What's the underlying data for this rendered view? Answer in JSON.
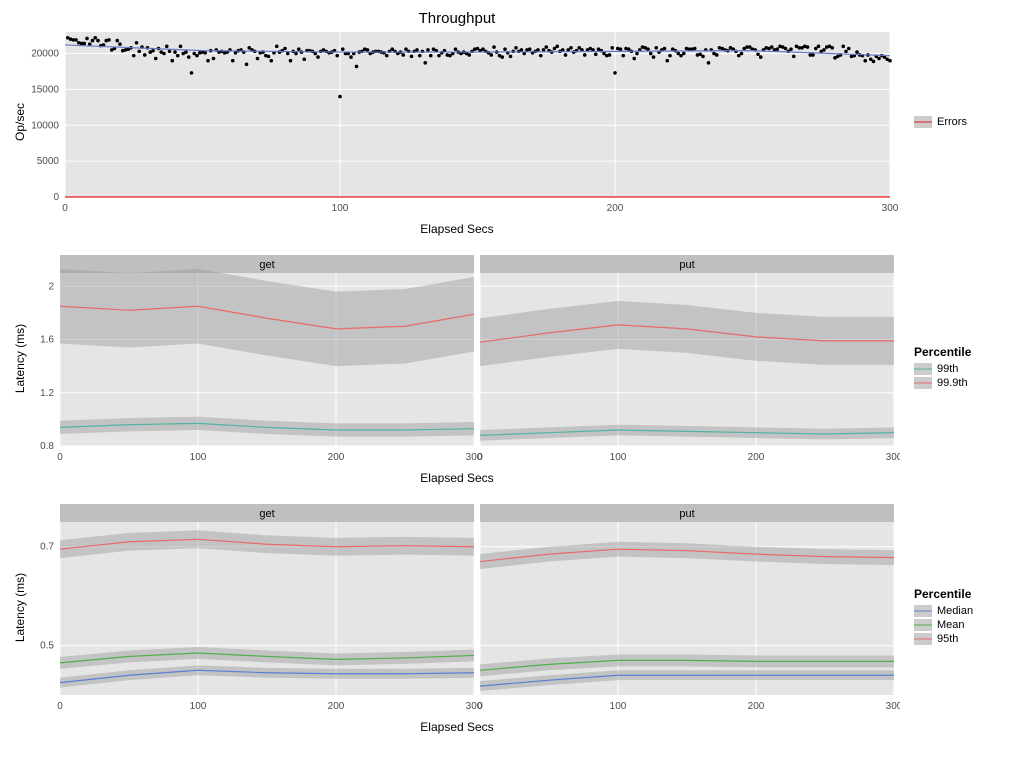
{
  "chart_data": [
    {
      "id": "throughput",
      "type": "scatter",
      "title": "Throughput",
      "xlabel": "Elapsed Secs",
      "ylabel": "Op/sec",
      "xlim": [
        0,
        300
      ],
      "ylim": [
        0,
        23000
      ],
      "x_ticks": [
        0,
        100,
        200,
        300
      ],
      "y_ticks": [
        0,
        5000,
        10000,
        15000,
        20000
      ],
      "legend": {
        "title": "",
        "items": [
          {
            "name": "Errors",
            "color": "#e41a1c"
          }
        ]
      },
      "series": [
        {
          "name": "throughput_pts",
          "style": "points",
          "color": "#000000",
          "x": [
            1,
            2,
            3,
            4,
            5,
            6,
            7,
            8,
            9,
            10,
            11,
            12,
            13,
            14,
            15,
            16,
            17,
            18,
            19,
            20,
            21,
            22,
            23,
            24,
            25,
            26,
            27,
            28,
            29,
            30,
            31,
            32,
            33,
            34,
            35,
            36,
            37,
            38,
            39,
            40,
            41,
            42,
            43,
            44,
            45,
            46,
            47,
            48,
            49,
            50,
            51,
            52,
            53,
            54,
            55,
            56,
            57,
            58,
            59,
            60,
            61,
            62,
            63,
            64,
            65,
            66,
            67,
            68,
            69,
            70,
            71,
            72,
            73,
            74,
            75,
            76,
            77,
            78,
            79,
            80,
            81,
            82,
            83,
            84,
            85,
            86,
            87,
            88,
            89,
            90,
            91,
            92,
            93,
            94,
            95,
            96,
            97,
            98,
            99,
            100,
            101,
            102,
            103,
            104,
            105,
            106,
            107,
            108,
            109,
            110,
            111,
            112,
            113,
            114,
            115,
            116,
            117,
            118,
            119,
            120,
            121,
            122,
            123,
            124,
            125,
            126,
            127,
            128,
            129,
            130,
            131,
            132,
            133,
            134,
            135,
            136,
            137,
            138,
            139,
            140,
            141,
            142,
            143,
            144,
            145,
            146,
            147,
            148,
            149,
            150,
            151,
            152,
            153,
            154,
            155,
            156,
            157,
            158,
            159,
            160,
            161,
            162,
            163,
            164,
            165,
            166,
            167,
            168,
            169,
            170,
            171,
            172,
            173,
            174,
            175,
            176,
            177,
            178,
            179,
            180,
            181,
            182,
            183,
            184,
            185,
            186,
            187,
            188,
            189,
            190,
            191,
            192,
            193,
            194,
            195,
            196,
            197,
            198,
            199,
            200,
            201,
            202,
            203,
            204,
            205,
            206,
            207,
            208,
            209,
            210,
            211,
            212,
            213,
            214,
            215,
            216,
            217,
            218,
            219,
            220,
            221,
            222,
            223,
            224,
            225,
            226,
            227,
            228,
            229,
            230,
            231,
            232,
            233,
            234,
            235,
            236,
            237,
            238,
            239,
            240,
            241,
            242,
            243,
            244,
            245,
            246,
            247,
            248,
            249,
            250,
            251,
            252,
            253,
            254,
            255,
            256,
            257,
            258,
            259,
            260,
            261,
            262,
            263,
            264,
            265,
            266,
            267,
            268,
            269,
            270,
            271,
            272,
            273,
            274,
            275,
            276,
            277,
            278,
            279,
            280,
            281,
            282,
            283,
            284,
            285,
            286,
            287,
            288,
            289,
            290,
            291,
            292,
            293,
            294,
            295,
            296,
            297,
            298,
            299,
            300
          ],
          "y": [
            22200,
            22000,
            21900,
            21900,
            21500,
            21400,
            21400,
            22100,
            21300,
            21800,
            22200,
            21800,
            21100,
            21200,
            21800,
            21900,
            20500,
            20700,
            21800,
            21300,
            20400,
            20500,
            20600,
            20800,
            19700,
            21500,
            20300,
            20900,
            19800,
            20800,
            20200,
            20400,
            19300,
            20700,
            20200,
            20000,
            21000,
            20300,
            19000,
            20200,
            19700,
            21000,
            20000,
            20200,
            19500,
            17300,
            20000,
            19700,
            20100,
            20200,
            20100,
            19000,
            20400,
            19300,
            20500,
            20200,
            20300,
            20100,
            20200,
            20500,
            19000,
            20100,
            20400,
            20500,
            20200,
            18500,
            20800,
            20500,
            20300,
            19300,
            20100,
            20200,
            19700,
            19600,
            19000,
            20100,
            21000,
            20200,
            20400,
            20700,
            20000,
            19000,
            20300,
            20000,
            20600,
            20200,
            19200,
            20400,
            20400,
            20300,
            20000,
            19500,
            20300,
            20500,
            20300,
            20100,
            20200,
            20400,
            19700,
            14000,
            20600,
            20000,
            20000,
            19500,
            20000,
            18200,
            20200,
            20300,
            20600,
            20500,
            20000,
            20200,
            20300,
            20300,
            20200,
            20100,
            19700,
            20300,
            20600,
            20300,
            20000,
            20200,
            19800,
            20600,
            20300,
            19600,
            20300,
            20500,
            19700,
            20300,
            18700,
            20500,
            19700,
            20600,
            20400,
            19700,
            20100,
            20400,
            19800,
            19700,
            20000,
            20600,
            20200,
            20000,
            20200,
            20000,
            19800,
            20300,
            20600,
            20700,
            20400,
            20600,
            20300,
            20100,
            19800,
            20900,
            20200,
            19700,
            19500,
            20600,
            20100,
            19600,
            20300,
            20800,
            20300,
            20500,
            20000,
            20500,
            20600,
            20100,
            20300,
            20500,
            19700,
            20500,
            20900,
            20400,
            20200,
            20700,
            21000,
            20300,
            20500,
            19800,
            20500,
            20800,
            20200,
            20400,
            20800,
            20500,
            19800,
            20500,
            20700,
            20500,
            19900,
            20600,
            20400,
            20000,
            19700,
            19800,
            20800,
            17300,
            20700,
            20600,
            19700,
            20700,
            20600,
            20300,
            19300,
            20000,
            20500,
            20900,
            20800,
            20600,
            20000,
            19500,
            20800,
            20200,
            20500,
            20700,
            19000,
            19700,
            20600,
            20400,
            20000,
            19700,
            20000,
            20700,
            20600,
            20600,
            20700,
            19800,
            19900,
            19600,
            20500,
            18700,
            20500,
            20000,
            19800,
            20800,
            20700,
            20500,
            20400,
            20800,
            20600,
            20300,
            19700,
            20000,
            20700,
            20900,
            20900,
            20600,
            20500,
            19900,
            19500,
            20500,
            20800,
            20700,
            20900,
            20500,
            20600,
            21000,
            20900,
            20700,
            20300,
            20600,
            19600,
            21000,
            20800,
            20800,
            21000,
            20900,
            19800,
            19800,
            20700,
            21000,
            20300,
            20500,
            20900,
            21000,
            20800,
            19400,
            19600,
            19800,
            21000,
            20300,
            20700,
            19600,
            19700,
            20200,
            19800,
            19700,
            19000,
            19800,
            19200,
            18900,
            19600,
            19300,
            19700,
            19500,
            19200,
            19000
          ]
        },
        {
          "name": "loess_fit",
          "style": "line",
          "color": "#6878c8",
          "x": [
            0,
            50,
            100,
            150,
            200,
            250,
            300
          ],
          "y": [
            21200,
            20400,
            20200,
            20200,
            20300,
            20400,
            19700
          ]
        },
        {
          "name": "Errors",
          "style": "line",
          "color": "#e41a1c",
          "x": [
            0,
            300
          ],
          "y": [
            0,
            0
          ]
        }
      ]
    },
    {
      "id": "latency_high",
      "type": "line",
      "xlabel": "Elapsed Secs",
      "ylabel": "Latency (ms)",
      "xlim": [
        0,
        300
      ],
      "ylim": [
        0.8,
        2.1
      ],
      "x_ticks": [
        0,
        100,
        200,
        300
      ],
      "y_ticks": [
        0.8,
        1.2,
        1.6,
        2.0
      ],
      "legend": {
        "title": "Percentile",
        "items": [
          {
            "name": "99th",
            "color": "#4fb3a5"
          },
          {
            "name": "99.9th",
            "color": "#e86a6a"
          }
        ]
      },
      "facets": [
        {
          "label": "get",
          "series": [
            {
              "name": "99th",
              "color": "#4fb3a5",
              "x": [
                0,
                50,
                100,
                150,
                200,
                250,
                300
              ],
              "y": [
                0.94,
                0.96,
                0.97,
                0.94,
                0.92,
                0.92,
                0.93
              ],
              "ci": 0.05
            },
            {
              "name": "99.9th",
              "color": "#e86a6a",
              "x": [
                0,
                50,
                100,
                150,
                200,
                250,
                300
              ],
              "y": [
                1.85,
                1.82,
                1.85,
                1.76,
                1.68,
                1.7,
                1.79
              ],
              "ci": 0.28
            }
          ]
        },
        {
          "label": "put",
          "series": [
            {
              "name": "99th",
              "color": "#4fb3a5",
              "x": [
                0,
                50,
                100,
                150,
                200,
                250,
                300
              ],
              "y": [
                0.88,
                0.9,
                0.92,
                0.91,
                0.9,
                0.89,
                0.9
              ],
              "ci": 0.04
            },
            {
              "name": "99.9th",
              "color": "#e86a6a",
              "x": [
                0,
                50,
                100,
                150,
                200,
                250,
                300
              ],
              "y": [
                1.58,
                1.65,
                1.71,
                1.68,
                1.62,
                1.59,
                1.59
              ],
              "ci": 0.18
            }
          ]
        }
      ]
    },
    {
      "id": "latency_low",
      "type": "line",
      "xlabel": "Elapsed Secs",
      "ylabel": "Latency (ms)",
      "xlim": [
        0,
        300
      ],
      "ylim": [
        0.4,
        0.75
      ],
      "x_ticks": [
        0,
        100,
        200,
        300
      ],
      "y_ticks": [
        0.5,
        0.7
      ],
      "legend": {
        "title": "Percentile",
        "items": [
          {
            "name": "Median",
            "color": "#5a7fd6"
          },
          {
            "name": "Mean",
            "color": "#4daf4a"
          },
          {
            "name": "95th",
            "color": "#e86a6a"
          }
        ]
      },
      "facets": [
        {
          "label": "get",
          "series": [
            {
              "name": "Median",
              "color": "#5a7fd6",
              "x": [
                0,
                50,
                100,
                150,
                200,
                250,
                300
              ],
              "y": [
                0.425,
                0.44,
                0.45,
                0.445,
                0.443,
                0.443,
                0.445
              ],
              "ci": 0.01
            },
            {
              "name": "Mean",
              "color": "#4daf4a",
              "x": [
                0,
                50,
                100,
                150,
                200,
                250,
                300
              ],
              "y": [
                0.465,
                0.478,
                0.485,
                0.478,
                0.472,
                0.475,
                0.48
              ],
              "ci": 0.012
            },
            {
              "name": "95th",
              "color": "#e86a6a",
              "x": [
                0,
                50,
                100,
                150,
                200,
                250,
                300
              ],
              "y": [
                0.695,
                0.71,
                0.715,
                0.705,
                0.7,
                0.702,
                0.7
              ],
              "ci": 0.018
            }
          ]
        },
        {
          "label": "put",
          "series": [
            {
              "name": "Median",
              "color": "#5a7fd6",
              "x": [
                0,
                50,
                100,
                150,
                200,
                250,
                300
              ],
              "y": [
                0.418,
                0.43,
                0.44,
                0.44,
                0.44,
                0.44,
                0.44
              ],
              "ci": 0.01
            },
            {
              "name": "Mean",
              "color": "#4daf4a",
              "x": [
                0,
                50,
                100,
                150,
                200,
                250,
                300
              ],
              "y": [
                0.45,
                0.462,
                0.47,
                0.47,
                0.468,
                0.468,
                0.468
              ],
              "ci": 0.012
            },
            {
              "name": "95th",
              "color": "#e86a6a",
              "x": [
                0,
                50,
                100,
                150,
                200,
                250,
                300
              ],
              "y": [
                0.67,
                0.685,
                0.695,
                0.692,
                0.685,
                0.68,
                0.678
              ],
              "ci": 0.015
            }
          ]
        }
      ]
    }
  ]
}
